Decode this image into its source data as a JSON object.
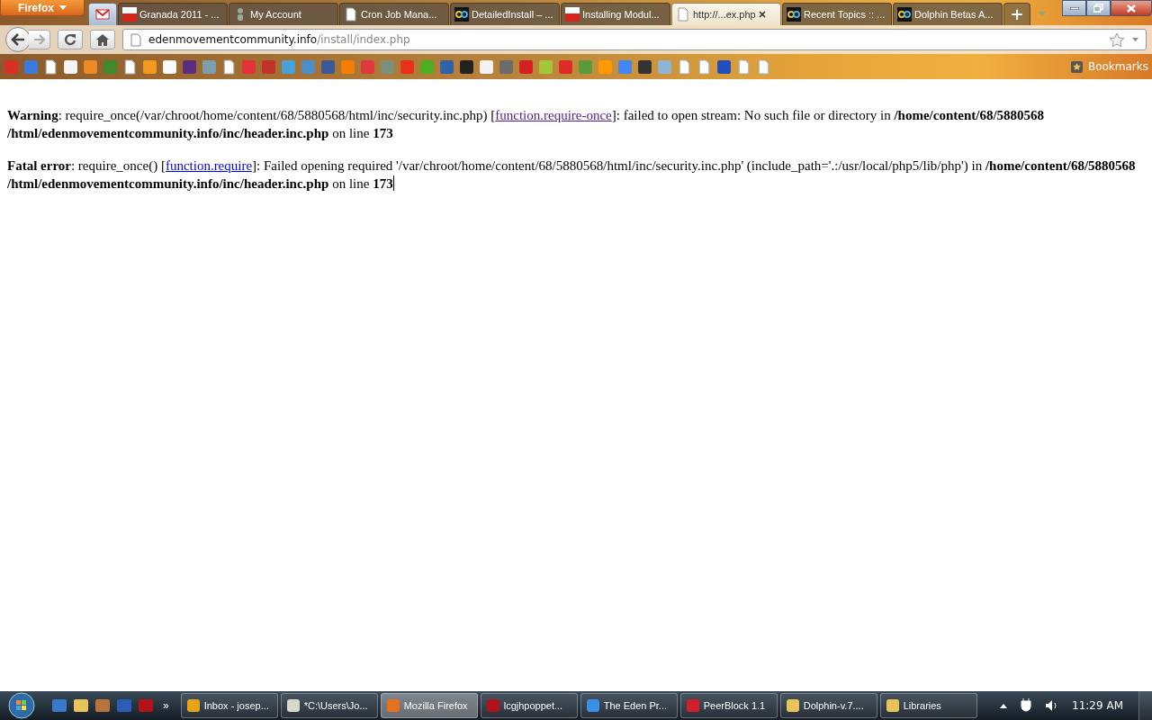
{
  "app_button": "Firefox",
  "tabs": [
    {
      "kind": "mail",
      "selected": false,
      "pinned": true
    },
    {
      "kind": "youtube",
      "label": "Granada 2011 - ...",
      "selected": false,
      "pinned": false
    },
    {
      "kind": "figure",
      "label": "My Account",
      "selected": false,
      "pinned": false
    },
    {
      "kind": "page",
      "label": "Cron Job Mana...",
      "selected": false,
      "pinned": false
    },
    {
      "kind": "infinity",
      "label": "DetailedInstall – ...",
      "selected": false,
      "pinned": false
    },
    {
      "kind": "youtube",
      "label": "Installing Modul...",
      "selected": false,
      "pinned": false
    },
    {
      "kind": "page",
      "label": "http://...ex.php",
      "selected": true,
      "pinned": false
    },
    {
      "kind": "infinity",
      "label": "Recent Topics :: ...",
      "selected": false,
      "pinned": false
    },
    {
      "kind": "infinity",
      "label": "Dolphin Betas A...",
      "selected": false,
      "pinned": false
    }
  ],
  "new_tab": "+",
  "address": {
    "host": "edenmovementcommunity.info",
    "path": "/install/index.php"
  },
  "bookmarks": [
    {
      "kind": "tile",
      "color": "#d93025"
    },
    {
      "kind": "tile",
      "color": "#3b7be0"
    },
    {
      "kind": "page",
      "color": "#ffffff"
    },
    {
      "kind": "tile",
      "color": "#f4f4f4"
    },
    {
      "kind": "tile",
      "color": "#f08a24"
    },
    {
      "kind": "tile",
      "color": "#3f8a2a"
    },
    {
      "kind": "page",
      "color": "#ffffff"
    },
    {
      "kind": "tile",
      "color": "#f39a1e"
    },
    {
      "kind": "tile",
      "color": "#fafafa"
    },
    {
      "kind": "tile",
      "color": "#5a2d82"
    },
    {
      "kind": "tile",
      "color": "#7f9db0"
    },
    {
      "kind": "page",
      "color": "#ffffff"
    },
    {
      "kind": "tile",
      "color": "#e53238"
    },
    {
      "kind": "tile",
      "color": "#c4302b"
    },
    {
      "kind": "tile",
      "color": "#46a3d9"
    },
    {
      "kind": "tile",
      "color": "#4a8fc9"
    },
    {
      "kind": "tile",
      "color": "#3b5998"
    },
    {
      "kind": "tile",
      "color": "#f57d00"
    },
    {
      "kind": "tile",
      "color": "#e0393e"
    },
    {
      "kind": "tile",
      "color": "#7a8f7c"
    },
    {
      "kind": "tile",
      "color": "#e8301c"
    },
    {
      "kind": "tile",
      "color": "#4caf1f"
    },
    {
      "kind": "tile",
      "color": "#2f62a8"
    },
    {
      "kind": "tile",
      "color": "#222222"
    },
    {
      "kind": "tile",
      "color": "#f2f2f2"
    },
    {
      "kind": "tile",
      "color": "#6b6b6b"
    },
    {
      "kind": "tile",
      "color": "#d42020"
    },
    {
      "kind": "tile",
      "color": "#a4c639"
    },
    {
      "kind": "tile",
      "color": "#e02a2a"
    },
    {
      "kind": "tile",
      "color": "#5b9a3c"
    },
    {
      "kind": "tile",
      "color": "#ff9900"
    },
    {
      "kind": "tile",
      "color": "#4285f4"
    },
    {
      "kind": "tile",
      "color": "#333333"
    },
    {
      "kind": "tile",
      "color": "#8fb4d6"
    },
    {
      "kind": "page",
      "color": "#ffffff"
    },
    {
      "kind": "page",
      "color": "#ffffff"
    },
    {
      "kind": "tile",
      "color": "#1f4fbf"
    },
    {
      "kind": "page",
      "color": "#ffffff"
    },
    {
      "kind": "page",
      "color": "#ffffff"
    }
  ],
  "bookmarks_menu": "Bookmarks",
  "messages": [
    {
      "segments": [
        {
          "kind": "bold",
          "text": "Warning"
        },
        {
          "kind": "text",
          "text": ": require_once(/var/chroot/home/content/68/5880568/html/inc/security.inc.php) ["
        },
        {
          "kind": "link",
          "text": "function.require-once",
          "visited": true
        },
        {
          "kind": "text",
          "text": "]: failed to open stream: No such file or directory in "
        },
        {
          "kind": "bold",
          "text": "/home/content/68/5880568"
        },
        {
          "kind": "bold",
          "text": "/html/edenmovementcommunity.info/inc/header.inc.php"
        },
        {
          "kind": "text",
          "text": " on line "
        },
        {
          "kind": "bold",
          "text": "173"
        }
      ],
      "cursor": false
    },
    {
      "segments": [
        {
          "kind": "bold",
          "text": "Fatal error"
        },
        {
          "kind": "text",
          "text": ": require_once() ["
        },
        {
          "kind": "link",
          "text": "function.require",
          "visited": false
        },
        {
          "kind": "text",
          "text": "]: Failed opening required '/var/chroot/home/content/68/5880568/html/inc/security.inc.php' (include_path='.:/usr/local/php5/lib/php') in "
        },
        {
          "kind": "bold",
          "text": "/home/content/68/5880568"
        },
        {
          "kind": "bold",
          "text": "/html/edenmovementcommunity.info/inc/header.inc.php"
        },
        {
          "kind": "text",
          "text": " on line "
        },
        {
          "kind": "bold",
          "text": "173"
        }
      ],
      "cursor": true
    }
  ],
  "quick_launch": [
    {
      "kind": "desktop"
    },
    {
      "kind": "folder"
    },
    {
      "kind": "library"
    },
    {
      "kind": "word"
    },
    {
      "kind": "filezilla"
    }
  ],
  "quick_launch_more": "»",
  "taskbar": [
    {
      "kind": "outlook",
      "label": "Inbox - josep...",
      "selected": false
    },
    {
      "kind": "notepad",
      "label": "*C:\\Users\\Jo...",
      "selected": false
    },
    {
      "kind": "firefox",
      "label": "Mozilla Firefox",
      "selected": true
    },
    {
      "kind": "filezilla",
      "label": "lcgjhpoppet...",
      "selected": false
    },
    {
      "kind": "ie",
      "label": "The Eden Pr...",
      "selected": false
    },
    {
      "kind": "peerblock",
      "label": "PeerBlock 1.1",
      "selected": false
    },
    {
      "kind": "folder",
      "label": "Dolphin-v.7....",
      "selected": false
    },
    {
      "kind": "libraries",
      "label": "Libraries",
      "selected": false
    }
  ],
  "clock": "11:29 AM"
}
